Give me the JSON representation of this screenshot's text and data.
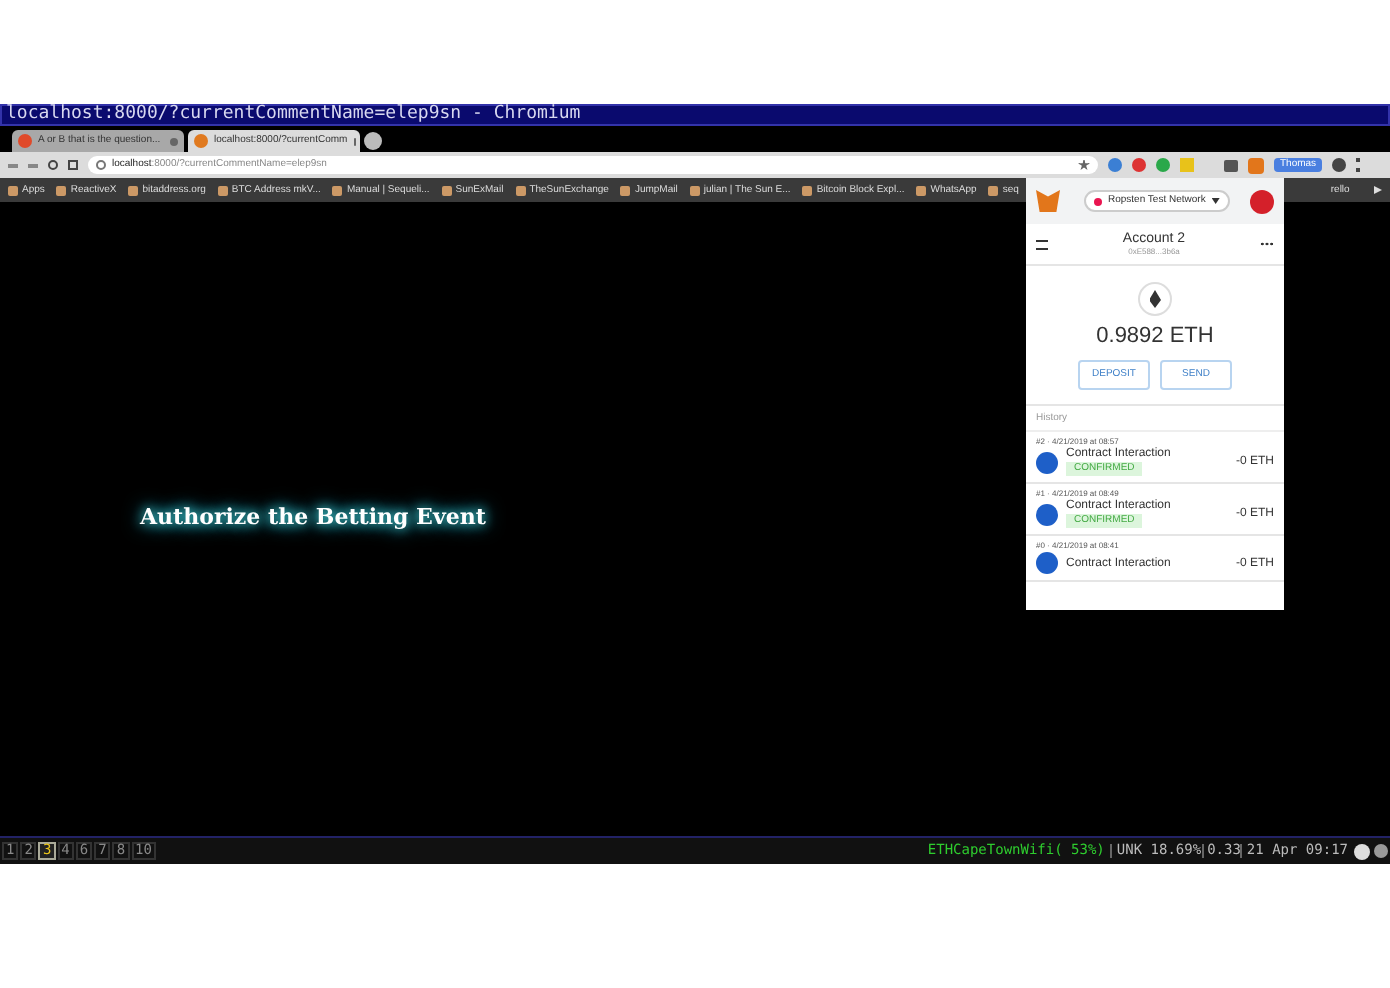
{
  "window": {
    "title": "localhost:8000/?currentCommentName=elep9sn - Chromium"
  },
  "tabs": [
    {
      "label": "A or B that is the question...",
      "selected": false
    },
    {
      "label": "localhost:8000/?currentComm",
      "selected": true
    }
  ],
  "address_bar": {
    "host": "localhost",
    "rest": ":8000/?currentCommentName=elep9sn"
  },
  "extensions": {
    "profile": "Thomas"
  },
  "bookmarks": [
    "Apps",
    "ReactiveX",
    "bitaddress.org",
    "BTC Address mkV...",
    "Manual | Sequeli...",
    "SunExMail",
    "TheSunExchange",
    "JumpMail",
    "julian | The Sun E...",
    "Bitcoin Block Expl...",
    "WhatsApp",
    "seq"
  ],
  "bookmarks_after_popup": "rello",
  "page": {
    "heading": "Authorize the Betting Event"
  },
  "wallet": {
    "network": "Ropsten Test Network",
    "account": "Account 2",
    "address": "0xE588...3b6a",
    "balance": "0.9892 ETH",
    "buttons": [
      "DEPOSIT",
      "SEND"
    ],
    "history_label": "History",
    "transactions": [
      {
        "meta": "#2 · 4/21/2019 at 08:57",
        "title": "Contract Interaction",
        "amount": "-0 ETH",
        "status": "CONFIRMED"
      },
      {
        "meta": "#1 · 4/21/2019 at 08:49",
        "title": "Contract Interaction",
        "amount": "-0 ETH",
        "status": "CONFIRMED"
      },
      {
        "meta": "#0 · 4/21/2019 at 08:41",
        "title": "Contract Interaction",
        "amount": "-0 ETH"
      }
    ]
  },
  "status_bar": {
    "workspaces": [
      {
        "label": "1",
        "selected": false
      },
      {
        "label": "2",
        "selected": false
      },
      {
        "label": "3",
        "selected": true
      },
      {
        "label": "4",
        "selected": false
      },
      {
        "label": "6",
        "selected": false
      },
      {
        "label": "7",
        "selected": false
      },
      {
        "label": "8",
        "selected": false
      },
      {
        "label": "10",
        "selected": false
      }
    ],
    "wifi": "ETHCapeTownWifi( 53%)",
    "cpu": "UNK 18.69%",
    "load": "0.33",
    "clock": "21 Apr 09:17"
  }
}
